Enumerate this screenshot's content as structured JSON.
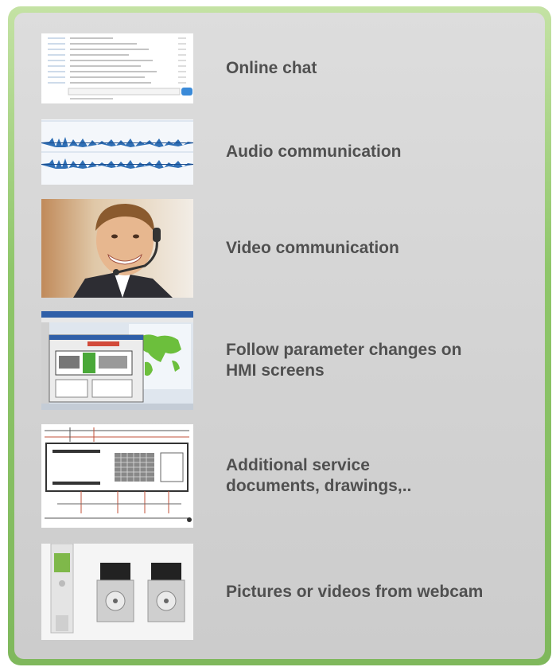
{
  "features": [
    {
      "label": "Online chat",
      "icon": "chat-screenshot-thumbnail"
    },
    {
      "label": "Audio communication",
      "icon": "audio-waveform-thumbnail"
    },
    {
      "label": "Video communication",
      "icon": "headset-person-thumbnail"
    },
    {
      "label": "Follow parameter changes on\nHMI screens",
      "icon": "hmi-screen-thumbnail"
    },
    {
      "label": "Additional service\ndocuments, drawings,..",
      "icon": "electrical-drawing-thumbnail"
    },
    {
      "label": "Pictures or videos from webcam",
      "icon": "servo-motors-photo-thumbnail"
    }
  ],
  "colors": {
    "panel": "#d4d4d4",
    "border_green": "#8fc66a",
    "text": "#505050",
    "accent_blue": "#2f6fb5"
  }
}
